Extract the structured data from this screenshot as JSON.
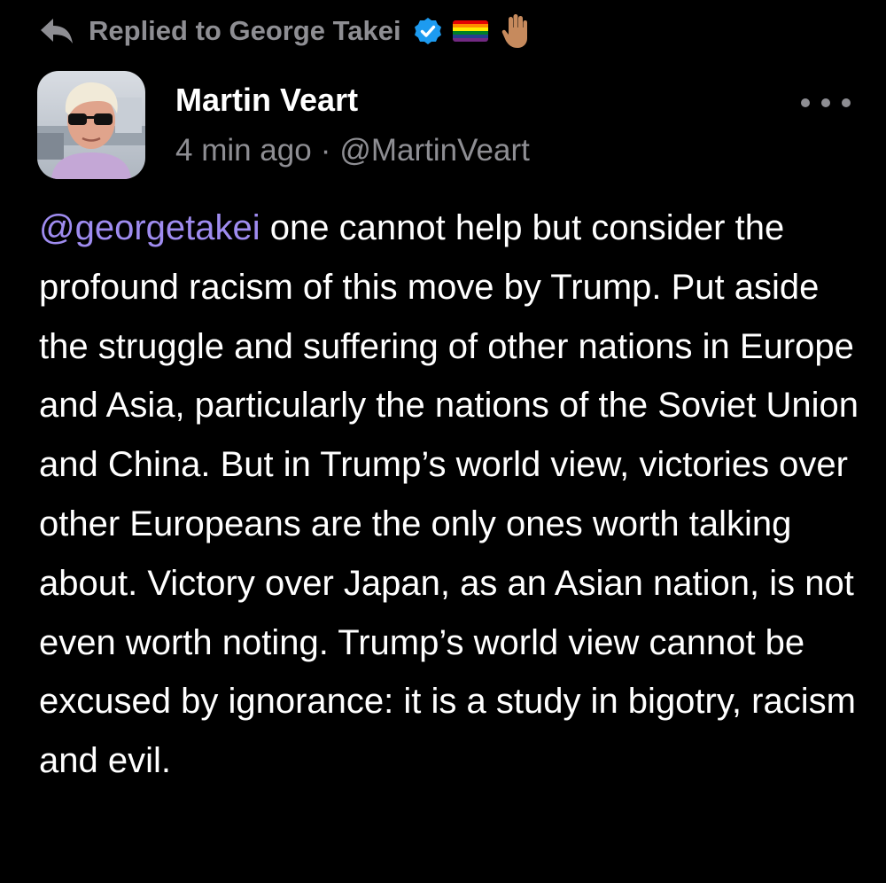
{
  "reply": {
    "prefix": "Replied to",
    "target_name": "George Takei",
    "icon": "reply-arrow-icon",
    "badges": [
      "verified-icon",
      "rainbow-flag-icon",
      "raised-hand-icon"
    ]
  },
  "post": {
    "author_name": "Martin Veart",
    "timestamp": "4 min ago",
    "separator": "·",
    "handle": "@MartinVeart",
    "mention": "@georgetakei",
    "text": " one cannot help but consider the profound racism of this move by Trump. Put aside the struggle and suffering of other nations in Europe and Asia, particularly the nations of the Soviet Union and China. But in Trump’s world view, victories over other Europeans are the only ones worth talking about. Victory over Japan, as an Asian nation, is not even worth noting. Trump’s world view cannot be excused by ignorance: it is a study in bigotry, racism and evil."
  },
  "colors": {
    "background": "#000000",
    "text": "#ffffff",
    "muted": "#8e8e93",
    "mention": "#9f8cf0",
    "verified": "#1d9bf0"
  }
}
